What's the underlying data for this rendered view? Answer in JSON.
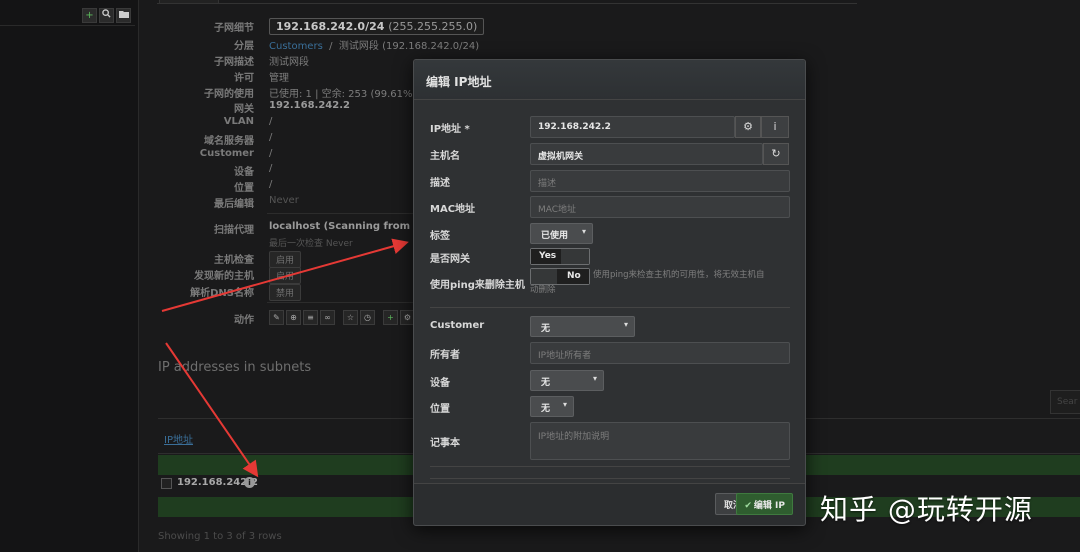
{
  "sidebar": {
    "add_icon": "plus-icon",
    "search_icon": "search-icon",
    "folder_icon": "folder-icon"
  },
  "details": {
    "subnet_label": "子网细节",
    "subnet_value": "192.168.242.0/24",
    "subnet_mask": "(255.255.255.0)",
    "section_label": "分层",
    "section_link": "Customers",
    "section_path": "测试网段 (192.168.242.0/24)",
    "description_label": "子网描述",
    "description_value": "测试网段",
    "permission_label": "许可",
    "permission_value": "管理",
    "usage_label": "子网的使用",
    "usage_value": "已使用: 1 | 空余: 253 (99.61%) |",
    "gateway_label": "网关",
    "gateway_value": "192.168.242.2",
    "vlan_label": "VLAN",
    "vlan_value": "/",
    "dns_label": "域名服务器",
    "dns_value": "/",
    "customer_label": "Customer",
    "customer_value": "/",
    "device_label": "设备",
    "device_value": "/",
    "location_label": "位置",
    "location_value": "/",
    "last_edit_label": "最后编辑",
    "last_edit_value": "Never",
    "scan_agent_label": "扫描代理",
    "scan_agent_value": "localhost (Scanning from local",
    "scan_agent_sub": "最后一次检查 Never",
    "host_check_label": "主机检查",
    "host_check_value": "启用",
    "discover_label": "发现新的主机",
    "discover_value": "启用",
    "resolve_dns_label": "解析DNS名称",
    "resolve_dns_value": "禁用",
    "actions_label": "动作"
  },
  "ip_section": {
    "title": "IP addresses in subnets",
    "column_ip": "IP地址",
    "row_ip": "192.168.242.2",
    "showing": "Showing 1 to 3 of 3 rows",
    "search_placeholder": "Sear"
  },
  "modal": {
    "title": "编辑 IP地址",
    "ip_label": "IP地址 *",
    "ip_value": "192.168.242.2",
    "hostname_label": "主机名",
    "hostname_value": "虚拟机网关",
    "description_label": "描述",
    "description_placeholder": "描述",
    "mac_label": "MAC地址",
    "mac_placeholder": "MAC地址",
    "tag_label": "标签",
    "tag_value": "已使用",
    "is_gateway_label": "是否网关",
    "is_gateway_value": "Yes",
    "ping_label": "使用ping来删除主机",
    "ping_value": "No",
    "ping_hint_1": "使用ping来检查主机的可用性，将无效主机自",
    "ping_hint_2": "动删除",
    "customer_label": "Customer",
    "customer_value": "无",
    "owner_label": "所有者",
    "owner_placeholder": "IP地址所有者",
    "device_label": "设备",
    "device_value": "无",
    "location_label": "位置",
    "location_value": "无",
    "notes_label": "记事本",
    "notes_placeholder": "IP地址的附加说明",
    "cancel_label": "取消",
    "submit_label": "编辑 IP"
  },
  "watermark": "知乎 @玩转开源",
  "colors": {
    "accent_green": "#5cb85c",
    "link_blue": "#3a6f99",
    "annotation_red": "#e53935"
  }
}
